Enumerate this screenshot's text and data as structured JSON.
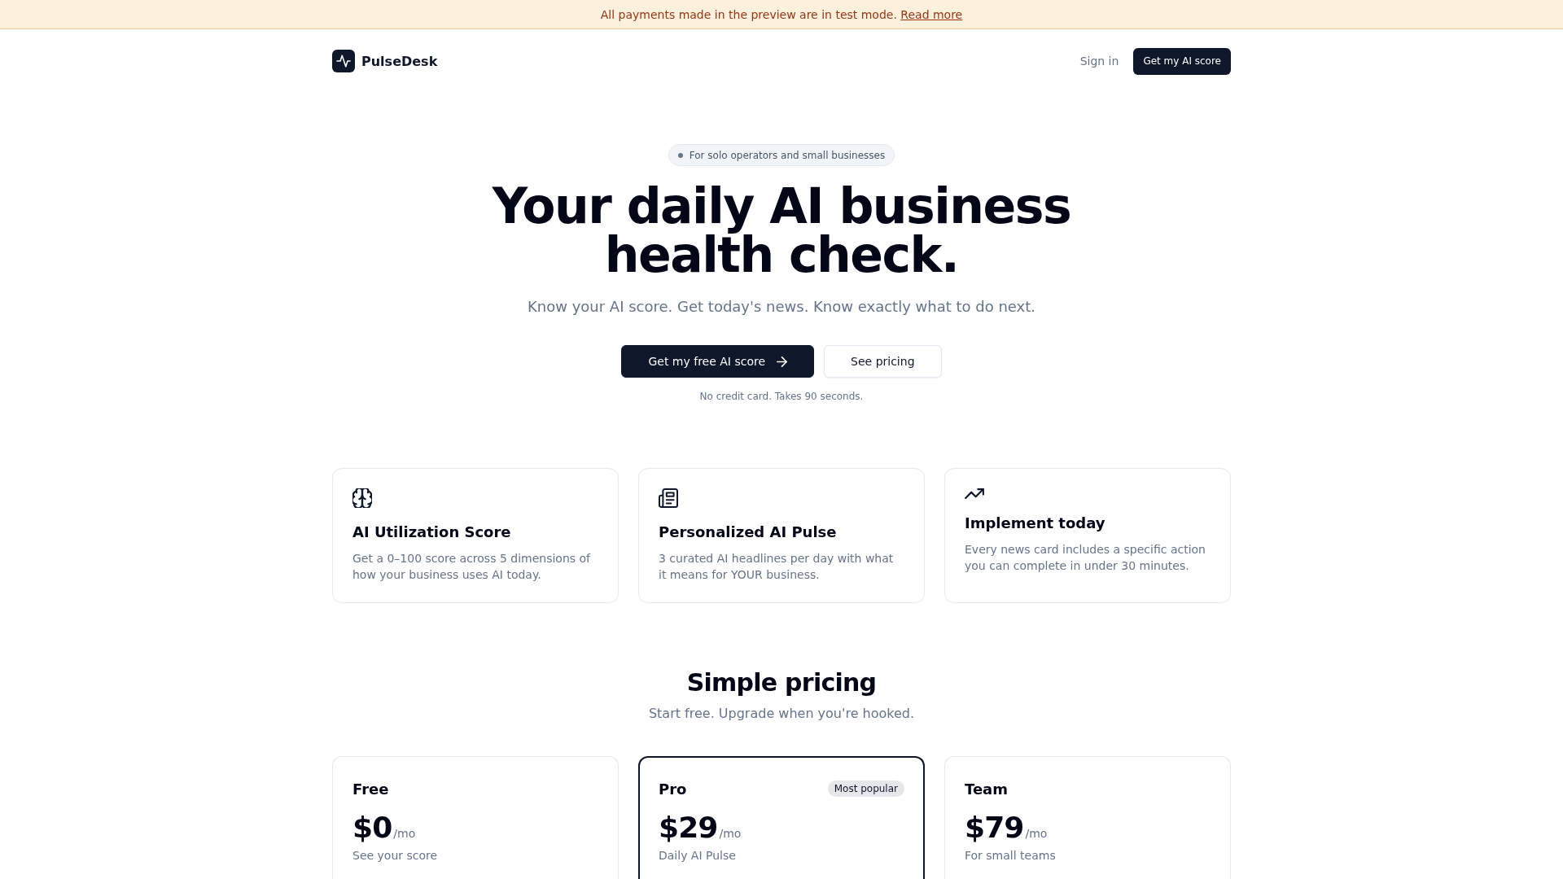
{
  "banner": {
    "text": "All payments made in the preview are in test mode.",
    "link": "Read more"
  },
  "header": {
    "brand": "PulseDesk",
    "sign_in": "Sign in",
    "cta": "Get my AI score"
  },
  "hero": {
    "badge": "For solo operators and small businesses",
    "title": "Your daily AI business health check.",
    "subtitle": "Know your AI score. Get today's news. Know exactly what to do next.",
    "buttons": [
      {
        "label": "Get my free AI score",
        "kind": "primary"
      },
      {
        "label": "See pricing",
        "kind": "secondary"
      }
    ],
    "note": "No credit card. Takes 90 seconds."
  },
  "features": [
    {
      "title": "AI Utilization Score",
      "description": "Get a 0–100 score across 5 dimensions of how your business uses AI today."
    },
    {
      "title": "Personalized AI Pulse",
      "description": "3 curated AI headlines per day with what it means for YOUR business."
    },
    {
      "title": "Implement today",
      "description": "Every news card includes a specific action you can complete in under 30 minutes."
    }
  ],
  "pricing": {
    "title": "Simple pricing",
    "subtitle": "Start free. Upgrade when you're hooked.",
    "plans": [
      {
        "name": "Free",
        "price": "$0",
        "period": "/mo",
        "tagline": "See your score",
        "highlighted": false
      },
      {
        "name": "Pro",
        "badge": "Most popular",
        "price": "$29",
        "period": "/mo",
        "tagline": "Daily AI Pulse",
        "highlighted": true
      },
      {
        "name": "Team",
        "price": "$79",
        "period": "/mo",
        "tagline": "For small teams",
        "highlighted": false
      }
    ]
  }
}
